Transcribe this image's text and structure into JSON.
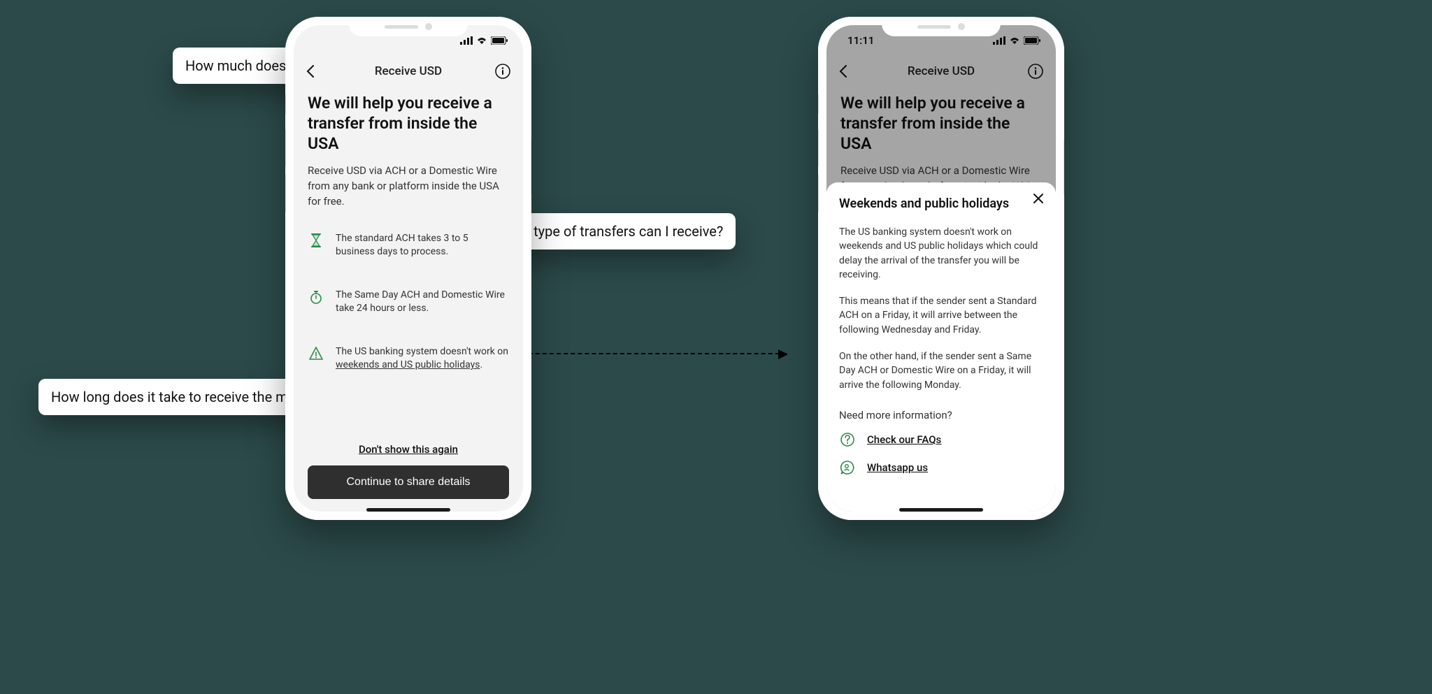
{
  "callouts": {
    "cost": "How much does it cost?",
    "types": "What type of transfers can I receive?",
    "time": "How long does it take to receive the money?"
  },
  "phone1": {
    "status": {
      "time": ""
    },
    "nav": {
      "title": "Receive USD"
    },
    "title": "We will help you receive a transfer from inside the USA",
    "subtitle": "Receive USD via ACH or a Domestic Wire from any bank or platform inside the USA for free.",
    "info": {
      "row1": "The standard ACH takes 3 to 5 business days to process.",
      "row2": "The Same Day ACH and Domestic Wire take 24 hours or less.",
      "row3_a": "The US banking system doesn't work on ",
      "row3_link": "weekends and US public holidays",
      "row3_b": "."
    },
    "actions": {
      "dont_show": "Don't show this again",
      "continue": "Continue to share details"
    }
  },
  "phone2": {
    "status": {
      "time": "11:11"
    },
    "nav": {
      "title": "Receive USD"
    },
    "title": "We will help you receive a transfer from inside the USA",
    "subtitle": "Receive USD via ACH or a Domestic Wire from any bank or platform inside the USA",
    "sheet": {
      "title": "Weekends and public holidays",
      "p1": "The US banking system doesn't work on weekends and US public holidays which could delay the arrival of the transfer you will be receiving.",
      "p2": "This means that if the sender sent a Standard ACH on a Friday, it will arrive between the following Wednesday and Friday.",
      "p3": "On the other hand, if the sender sent a Same Day ACH or Domestic Wire on a Friday, it will arrive the following Monday.",
      "more": "Need more information?",
      "faqs": "Check our FAQs",
      "whatsapp": "Whatsapp us"
    }
  }
}
